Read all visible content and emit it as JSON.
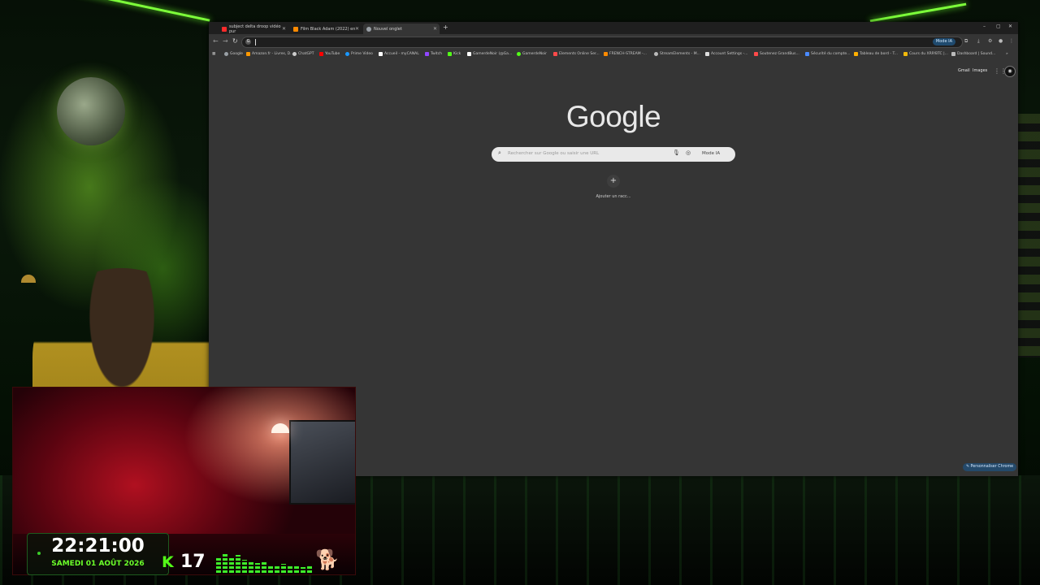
{
  "browser": {
    "tabs": [
      {
        "title": "subject delta droop vidéo pur",
        "favicon_color": "#ff2b2b"
      },
      {
        "title": "Film Black Adam (2022) en",
        "favicon_color": "#ff8a00"
      },
      {
        "title": "Nouvel onglet",
        "favicon_color": "#9aa0a6"
      }
    ],
    "new_tab": "+",
    "window_controls": [
      "–",
      "▢",
      "✕"
    ],
    "omnibox": {
      "mode_ia": "Mode IA"
    },
    "bookmarks": [
      {
        "label": "Google",
        "color": "#9aa0a6"
      },
      {
        "label": "Amazon.fr - Livres, D...",
        "color": "#ff9900"
      },
      {
        "label": "ChatGPT",
        "color": "#cccccc"
      },
      {
        "label": "YouTube",
        "color": "#ff0000"
      },
      {
        "label": "Prime Video",
        "color": "#1a98ff"
      },
      {
        "label": "Accueil - myCANAL",
        "color": "#ffffff"
      },
      {
        "label": "Twitch",
        "color": "#9146ff"
      },
      {
        "label": "Kick",
        "color": "#53fc18"
      },
      {
        "label": "GamerdeNoir (@Ga...",
        "color": "#ffffff"
      },
      {
        "label": "GamerdeNoir",
        "color": "#53fc18"
      },
      {
        "label": "Elements Online Ser...",
        "color": "#ff4a4a"
      },
      {
        "label": "FRENCH-STREAM -...",
        "color": "#ff8a00"
      },
      {
        "label": "StreamElements - M...",
        "color": "#bbbbbb"
      },
      {
        "label": "Account Settings -...",
        "color": "#dddddd"
      },
      {
        "label": "Soutenez GrandBus...",
        "color": "#ff4a4a"
      },
      {
        "label": "Sécurité du compte...",
        "color": "#4a8aff"
      },
      {
        "label": "Tableau de bord - T...",
        "color": "#ffb000"
      },
      {
        "label": "Cours du XRP/BTC |...",
        "color": "#f0b90b"
      },
      {
        "label": "Dashboard | Sound...",
        "color": "#bbbbbb"
      }
    ],
    "top_links": {
      "gmail": "Gmail",
      "images": "Images"
    },
    "logo": "Google",
    "search": {
      "placeholder": "Rechercher sur Google ou saisir une URL",
      "mode_ia": "Mode IA"
    },
    "shortcut": {
      "icon": "+",
      "label": "Ajouter un racc..."
    },
    "customize": "Personnaliser Chrome"
  },
  "overlay": {
    "time": "22:21:00",
    "date": "SAMEDI 01 AOÛT 2026",
    "kick_logo": "K",
    "kick_count": "17",
    "accent": "#53fc18"
  }
}
